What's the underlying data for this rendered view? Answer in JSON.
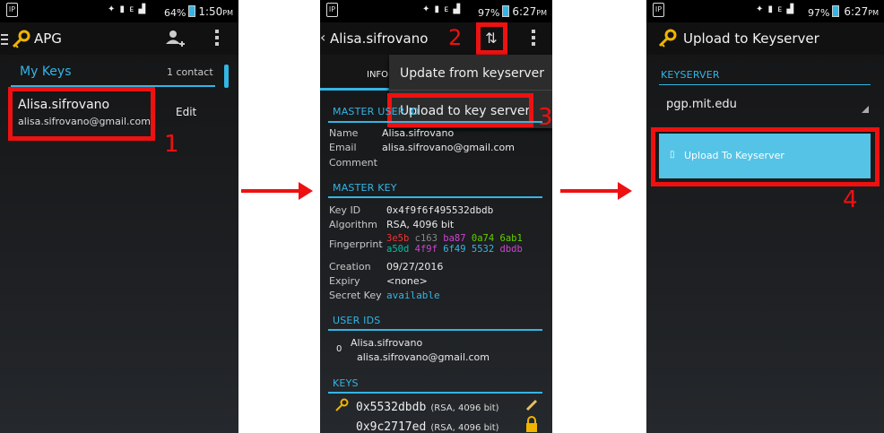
{
  "phone1": {
    "status": {
      "logo": "IP",
      "signal": "✦ ▮ ᴇ ▟",
      "battery": "64%",
      "time": "1:50",
      "ampm": "PM"
    },
    "actionbar": {
      "title": "APG"
    },
    "list": {
      "header": "My Keys",
      "count": "1 contact"
    },
    "key": {
      "name": "Alisa.sifrovano",
      "email": "alisa.sifrovano@gmail.com",
      "edit": "Edit"
    },
    "step": "1"
  },
  "phone2": {
    "status": {
      "logo": "IP",
      "signal": "✦ ▮ ᴇ ▟",
      "battery": "97%",
      "time": "6:27",
      "ampm": "PM"
    },
    "actionbar": {
      "back": "‹",
      "title": "Alisa.sifrovano",
      "step": "2"
    },
    "tab": {
      "label": "INFO"
    },
    "menu": {
      "item1": "Update from keyserver",
      "item2": "Upload to key server",
      "step": "3"
    },
    "master_uid": {
      "header": "MASTER USER ID",
      "name_label": "Name",
      "name": "Alisa.sifrovano",
      "email_label": "Email",
      "email": "alisa.sifrovano@gmail.com",
      "comment_label": "Comment"
    },
    "master_key": {
      "header": "MASTER KEY",
      "keyid_label": "Key ID",
      "keyid": "0x4f9f6f495532dbdb",
      "algo_label": "Algorithm",
      "algo": "RSA, 4096 bit",
      "fp_label": "Fingerprint",
      "fp": [
        "3e5b",
        "c163",
        "ba87",
        "0a74",
        "6ab1",
        "a50d",
        "4f9f",
        "6f49",
        "5532",
        "dbdb"
      ],
      "creation_label": "Creation",
      "creation": "09/27/2016",
      "expiry_label": "Expiry",
      "expiry": "<none>",
      "secret_label": "Secret Key",
      "secret": "available"
    },
    "user_ids": {
      "header": "USER IDS",
      "index": "0",
      "name": "Alisa.sifrovano",
      "email": "alisa.sifrovano@gmail.com"
    },
    "keys": {
      "header": "KEYS",
      "k1": {
        "id": "0x5532dbdb",
        "info": "(RSA, 4096 bit)"
      },
      "k2": {
        "id": "0x9c2717ed",
        "info": "(RSA, 4096 bit)"
      }
    }
  },
  "phone3": {
    "status": {
      "logo": "IP",
      "signal": "✦ ▮ ᴇ ▟",
      "battery": "97%",
      "time": "6:27",
      "ampm": "PM"
    },
    "actionbar": {
      "title": "Upload to Keyserver"
    },
    "section": {
      "header": "KEYSERVER"
    },
    "server": {
      "value": "pgp.mit.edu"
    },
    "button": {
      "icon": "▯",
      "label": "Upload To Keyserver"
    },
    "step": "4"
  },
  "colors": {
    "accent": "#33b5e5",
    "highlight": "#ee1111",
    "fingerprint": [
      "#ee3333",
      "#888888",
      "#cc44cc",
      "#66cc00",
      "#66cc00",
      "#00c0a0",
      "#cc44cc",
      "#33b5e5",
      "#33b5e5",
      "#cc44cc"
    ]
  }
}
